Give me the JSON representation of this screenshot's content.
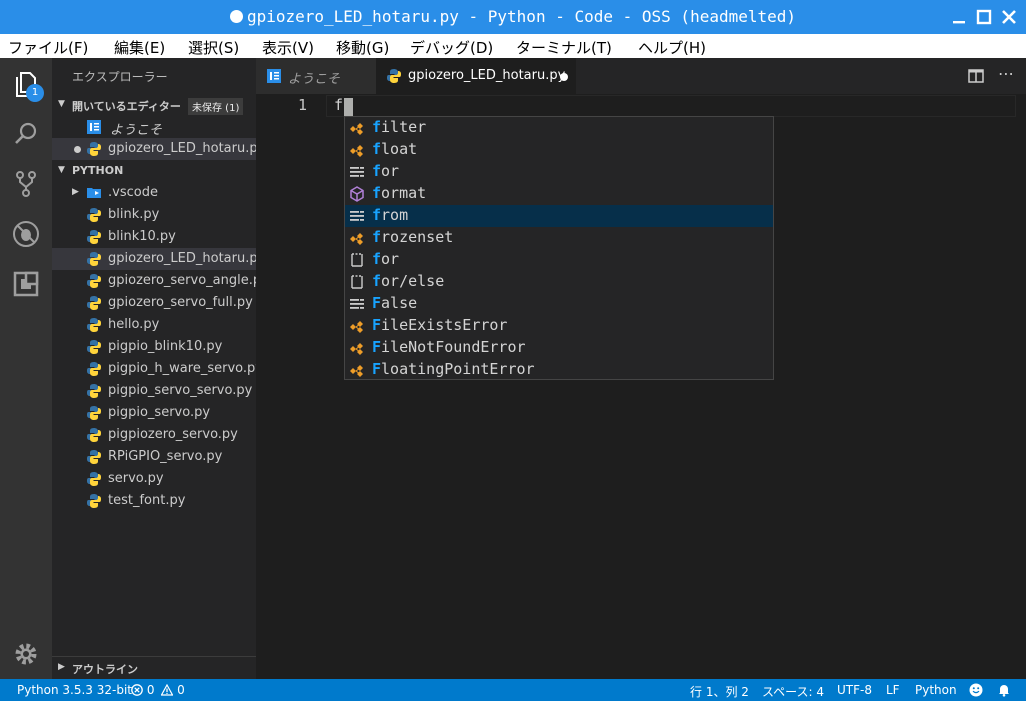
{
  "window": {
    "title": "gpiozero_LED_hotaru.py - Python - Code - OSS (headmelted)"
  },
  "menu": [
    "ファイル(F)",
    "編集(E)",
    "選択(S)",
    "表示(V)",
    "移動(G)",
    "デバッグ(D)",
    "ターミナル(T)",
    "ヘルプ(H)"
  ],
  "activity": {
    "explorer_badge": "1"
  },
  "sidebar": {
    "title": "エクスプローラー",
    "open_editors": {
      "label": "開いているエディター",
      "unsaved": "未保存 (1)",
      "items": [
        "ようこそ",
        "gpiozero_LED_hotaru.py"
      ]
    },
    "folder": {
      "label": "PYTHON",
      "items": [
        ".vscode",
        "blink.py",
        "blink10.py",
        "gpiozero_LED_hotaru.py",
        "gpiozero_servo_angle.py",
        "gpiozero_servo_full.py",
        "hello.py",
        "pigpio_blink10.py",
        "pigpio_h_ware_servo.py",
        "pigpio_servo_servo.py",
        "pigpio_servo.py",
        "pigpiozero_servo.py",
        "RPiGPIO_servo.py",
        "servo.py",
        "test_font.py"
      ]
    },
    "outline": "アウトライン"
  },
  "tabs": [
    {
      "label": "ようこそ"
    },
    {
      "label": "gpiozero_LED_hotaru.py"
    }
  ],
  "editor": {
    "line_number": "1",
    "code": "f"
  },
  "suggestions": [
    {
      "match": "f",
      "rest": "ilter",
      "kind": "class"
    },
    {
      "match": "f",
      "rest": "loat",
      "kind": "class"
    },
    {
      "match": "f",
      "rest": "or",
      "kind": "keyword"
    },
    {
      "match": "f",
      "rest": "ormat",
      "kind": "method"
    },
    {
      "match": "f",
      "rest": "rom",
      "kind": "keyword"
    },
    {
      "match": "f",
      "rest": "rozenset",
      "kind": "class"
    },
    {
      "match": "f",
      "rest": "or",
      "kind": "snippet"
    },
    {
      "match": "f",
      "rest": "or/else",
      "kind": "snippet"
    },
    {
      "match": "F",
      "rest": "alse",
      "kind": "keyword"
    },
    {
      "match": "F",
      "rest": "ileExistsError",
      "kind": "class"
    },
    {
      "match": "F",
      "rest": "ileNotFoundError",
      "kind": "class"
    },
    {
      "match": "F",
      "rest": "loatingPointError",
      "kind": "class"
    }
  ],
  "status": {
    "interpreter": "Python 3.5.3 32-bit",
    "errors": "0",
    "warnings": "0",
    "position": "行 1、列 2",
    "spaces": "スペース: 4",
    "encoding": "UTF-8",
    "eol": "LF",
    "language": "Python"
  },
  "colors": {
    "accent": "#007acc",
    "titlebar": "#2a8ee8",
    "match_highlight": "#18a3ff",
    "python_blue": "#3572a5",
    "python_yellow": "#ffd43b"
  }
}
